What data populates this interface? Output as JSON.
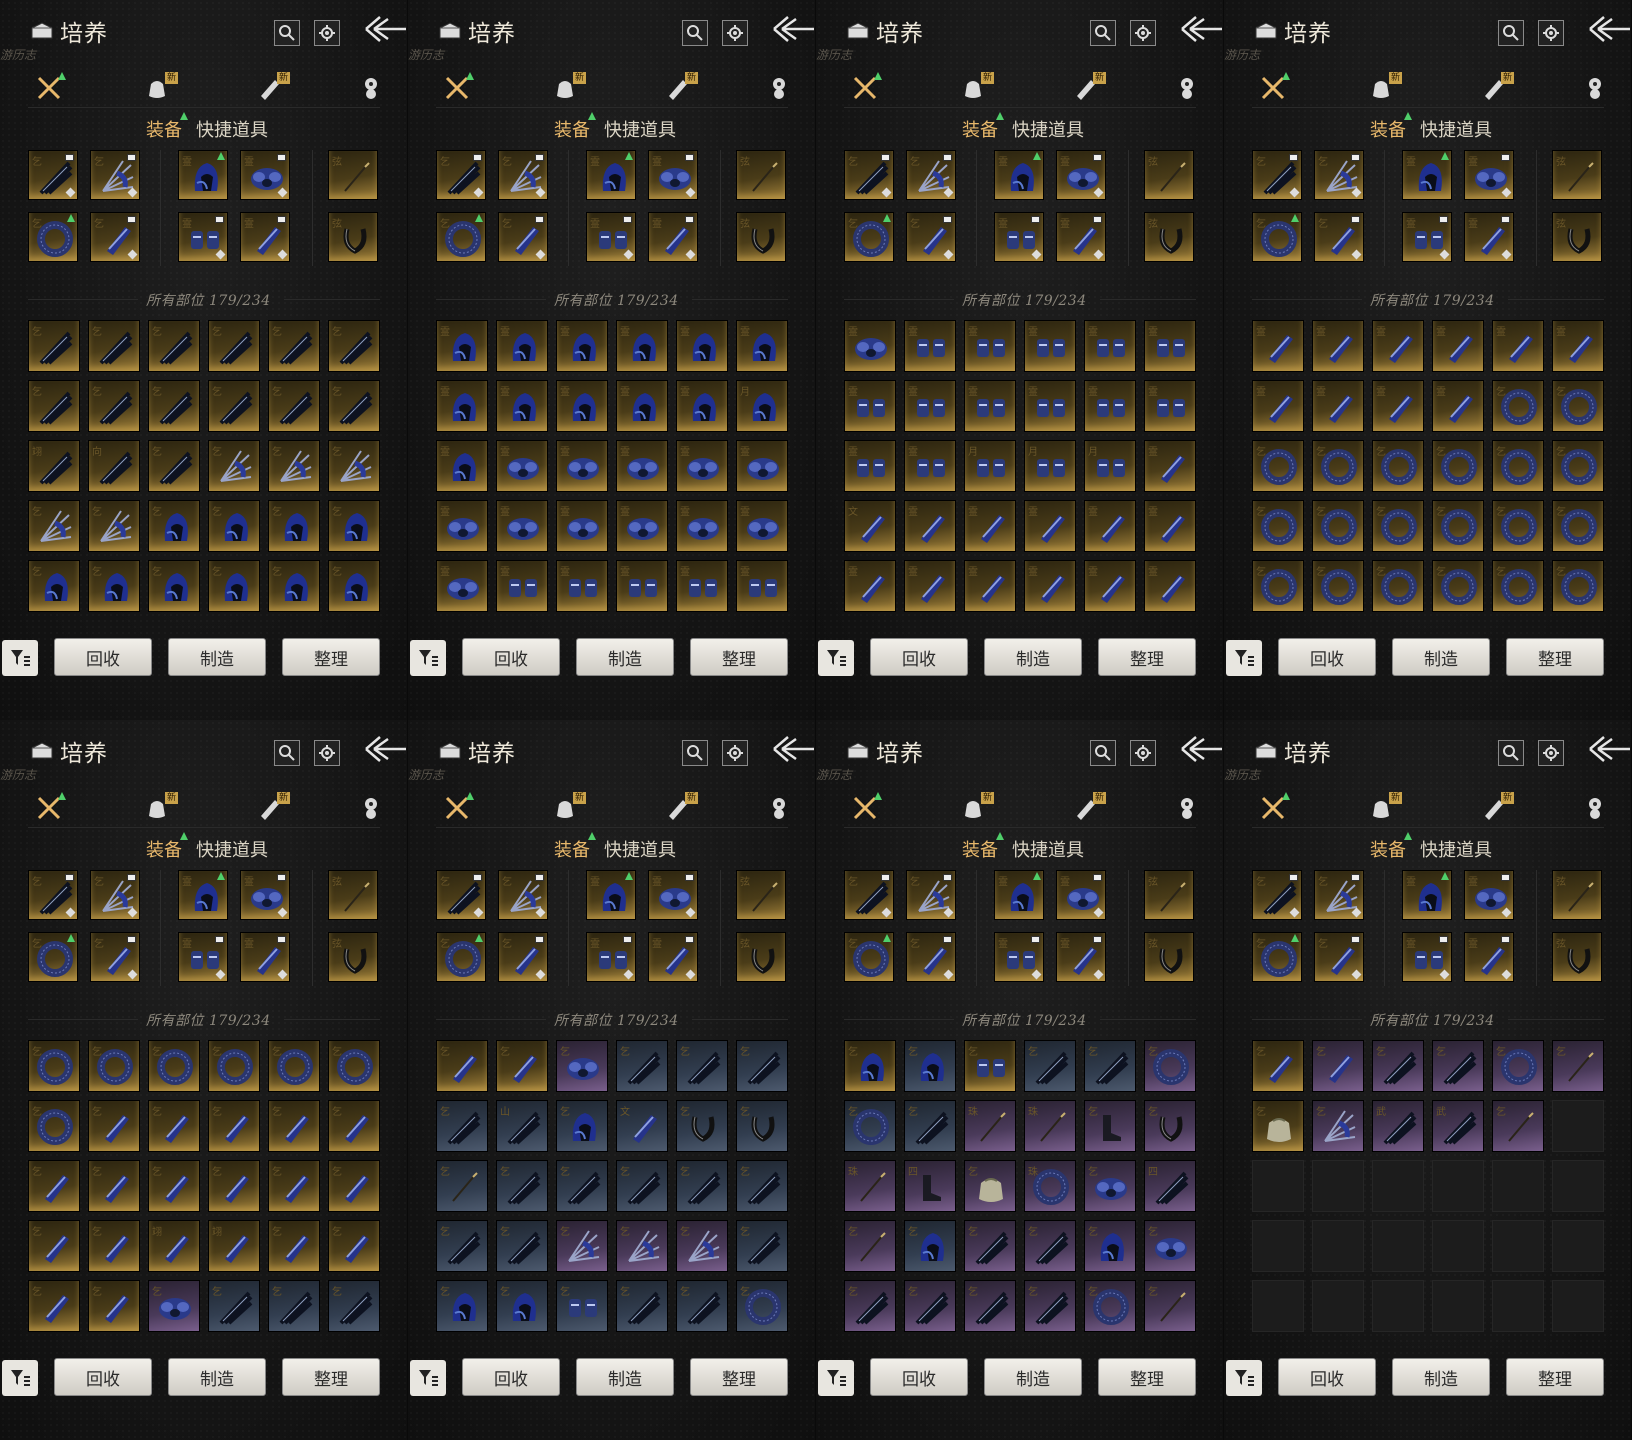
{
  "ui": {
    "title": "培养",
    "header_sub": "游历志",
    "tab_new_badge": "新",
    "subtab_equipment": "装备",
    "subtab_quick_items": "快捷道具",
    "section_label": "所有部位 179/234",
    "buttons": {
      "recycle": "回收",
      "craft": "制造",
      "sort": "整理"
    },
    "icons": {
      "header": "chest-icon",
      "search": "search-icon",
      "settings": "gear-icon",
      "back": "back-arrow-icon",
      "filter": "filter-icon",
      "tabs": [
        "crossed-swords-icon",
        "pouch-icon",
        "scroll-icon",
        "sigil-icon"
      ]
    }
  },
  "equipped": [
    {
      "glyph": "乞",
      "kind": "spear",
      "mark": true
    },
    {
      "glyph": "乞",
      "kind": "fan",
      "mark": true
    },
    {
      "glyph": "霊",
      "kind": "hood",
      "upg": true
    },
    {
      "glyph": "霊",
      "kind": "armor",
      "mark": true
    },
    {
      "glyph": "弦",
      "kind": "wand",
      "dots": true
    },
    {
      "glyph": "乞",
      "kind": "ring",
      "upg": true
    },
    {
      "glyph": "乞",
      "kind": "bracer",
      "mark": true
    },
    {
      "glyph": "霊",
      "kind": "gloves",
      "mark": true
    },
    {
      "glyph": "霊",
      "kind": "bracer",
      "mark": true
    },
    {
      "glyph": "弦",
      "kind": "amulet",
      "dots": true
    }
  ],
  "panels": [
    {
      "rows": [
        [
          "gold:spear:乞",
          "gold:spear:乞",
          "gold:spear:乞",
          "gold:spear:乞",
          "gold:spear:乞",
          "gold:spear:乞"
        ],
        [
          "gold:spear:乞",
          "gold:spear:乞",
          "gold:spear:乞",
          "gold:spear:乞",
          "gold:spear:乞",
          "gold:spear:乞"
        ],
        [
          "gold:spear:翊",
          "gold:spear:向",
          "gold:spear:乞",
          "gold:fan:乞",
          "gold:fan:乞",
          "gold:fan:乞"
        ],
        [
          "gold:fan:乞",
          "gold:fan:乞",
          "gold:hood:乞",
          "gold:hood:乞",
          "gold:hood:乞",
          "gold:hood:乞"
        ],
        [
          "gold:hood:乞",
          "gold:hood:乞",
          "gold:hood:乞",
          "gold:hood:乞",
          "gold:hood:乞",
          "gold:hood:乞"
        ]
      ]
    },
    {
      "rows": [
        [
          "gold:hood:霊",
          "gold:hood:霊",
          "gold:hood:霊",
          "gold:hood:霊",
          "gold:hood:霊",
          "gold:hood:霊"
        ],
        [
          "gold:hood:霊",
          "gold:hood:霊",
          "gold:hood:霊",
          "gold:hood:霊",
          "gold:hood:霊",
          "gold:hood:月"
        ],
        [
          "gold:hood:霊",
          "gold:armor:霊",
          "gold:armor:霊",
          "gold:armor:霊",
          "gold:armor:霊",
          "gold:armor:霊"
        ],
        [
          "gold:armor:霊",
          "gold:armor:霊",
          "gold:armor:霊",
          "gold:armor:霊",
          "gold:armor:霊",
          "gold:armor:霊"
        ],
        [
          "gold:armor:霊",
          "gold:gloves:霊",
          "gold:gloves:霊",
          "gold:gloves:霊",
          "gold:gloves:霊",
          "gold:gloves:霊"
        ]
      ]
    },
    {
      "rows": [
        [
          "gold:armor:霊",
          "gold:gloves:霊",
          "gold:gloves:霊",
          "gold:gloves:霊",
          "gold:gloves:霊",
          "gold:gloves:霊"
        ],
        [
          "gold:gloves:霊",
          "gold:gloves:霊",
          "gold:gloves:霊",
          "gold:gloves:霊",
          "gold:gloves:霊",
          "gold:gloves:霊"
        ],
        [
          "gold:gloves:霊",
          "gold:gloves:霊",
          "gold:gloves:月",
          "gold:gloves:月",
          "gold:gloves:月",
          "gold:bracer:霊"
        ],
        [
          "gold:bracer:文",
          "gold:bracer:霊",
          "gold:bracer:霊",
          "gold:bracer:霊",
          "gold:bracer:霊",
          "gold:bracer:霊"
        ],
        [
          "gold:bracer:霊",
          "gold:bracer:霊",
          "gold:bracer:霊",
          "gold:bracer:霊",
          "gold:bracer:霊",
          "gold:bracer:霊"
        ]
      ]
    },
    {
      "rows": [
        [
          "gold:bracer:霊",
          "gold:bracer:霊",
          "gold:bracer:霊",
          "gold:bracer:霊",
          "gold:bracer:霊",
          "gold:bracer:霊"
        ],
        [
          "gold:bracer:霊",
          "gold:bracer:霊",
          "gold:bracer:霊",
          "gold:bracer:霊",
          "gold:ring:乞",
          "gold:ring:乞"
        ],
        [
          "gold:ring:乞",
          "gold:ring:乞",
          "gold:ring:乞",
          "gold:ring:乞",
          "gold:ring:乞",
          "gold:ring:乞"
        ],
        [
          "gold:ring:乞",
          "gold:ring:乞",
          "gold:ring:乞",
          "gold:ring:乞",
          "gold:ring:乞",
          "gold:ring:乞"
        ],
        [
          "gold:ring:乞",
          "gold:ring:乞",
          "gold:ring:乞",
          "gold:ring:乞",
          "gold:ring:乞",
          "gold:ring:乞"
        ]
      ]
    },
    {
      "rows": [
        [
          "gold:ring:乞",
          "gold:ring:乞",
          "gold:ring:乞",
          "gold:ring:乞",
          "gold:ring:乞",
          "gold:ring:乞"
        ],
        [
          "gold:ring:乞",
          "gold:bracer:乞",
          "gold:bracer:乞",
          "gold:bracer:乞",
          "gold:bracer:乞",
          "gold:bracer:乞"
        ],
        [
          "gold:bracer:乞",
          "gold:bracer:乞",
          "gold:bracer:乞",
          "gold:bracer:乞",
          "gold:bracer:乞",
          "gold:bracer:乞"
        ],
        [
          "gold:bracer:乞",
          "gold:bracer:乞",
          "gold:bracer:翊",
          "gold:bracer:翊",
          "gold:bracer:乞",
          "gold:bracer:乞"
        ],
        [
          "gold:bracer:乞",
          "gold:bracer:乞",
          "purple:armor:乞",
          "blue:spear:乞",
          "blue:spear:乞",
          "blue:spear:乞"
        ]
      ]
    },
    {
      "rows": [
        [
          "gold:bracer:乞",
          "gold:bracer:乞",
          "purple:armor:乞",
          "blue:spear:乞",
          "blue:spear:乞",
          "blue:spear:乞"
        ],
        [
          "blue:spear:乞",
          "blue:spear:山",
          "blue:hood:乞",
          "blue:bracer:文",
          "blue:amulet:乞",
          "blue:amulet:乞"
        ],
        [
          "blue:wand:乞",
          "blue:spear:乞",
          "blue:spear:乞",
          "blue:spear:乞",
          "blue:spear:乞",
          "blue:spear:乞"
        ],
        [
          "blue:spear:乞",
          "blue:spear:乞",
          "purple:fan:乞",
          "purple:fan:乞",
          "purple:fan:乞",
          "blue:spear:乞"
        ],
        [
          "blue:hood:乞",
          "blue:hood:乞",
          "blue:gloves:乞",
          "blue:spear:乞",
          "blue:spear:乞",
          "blue:ring:乞"
        ]
      ]
    },
    {
      "rows": [
        [
          "gold:hood:乞",
          "blue:hood:乞",
          "gold:gloves:乞",
          "blue:spear:乞",
          "blue:spear:乞",
          "purple:ring:乞"
        ],
        [
          "blue:ring:乞",
          "blue:spear:乞",
          "purple:wand:珠",
          "purple:wand:珠",
          "purple:boots:乞",
          "purple:amulet:乞"
        ],
        [
          "purple:wand:珠",
          "purple:boots:四",
          "purple:pouch:乞",
          "purple:ring:珠",
          "purple:armor:乞",
          "purple:spear:四"
        ],
        [
          "purple:wand:乞",
          "blue:hood:乞",
          "purple:spear:乞",
          "purple:spear:乞",
          "purple:hood:乞",
          "purple:armor:乞"
        ],
        [
          "purple:spear:乞",
          "purple:spear:乞",
          "purple:spear:乞",
          "purple:spear:乞",
          "purple:ring:乞",
          "purple:wand:乞"
        ]
      ]
    },
    {
      "rows": [
        [
          "gold:bracer:乞",
          "purple:bracer:乞",
          "purple:spear:乞",
          "purple:spear:乞",
          "purple:ring:乞",
          "purple:wand:乞"
        ],
        [
          "gold:pouch:乞",
          "purple:fan:乞",
          "purple:spear:武",
          "purple:spear:武",
          "purple:wand:乞",
          "empty"
        ],
        [
          "empty",
          "empty",
          "empty",
          "empty",
          "empty",
          "empty"
        ],
        [
          "empty",
          "empty",
          "empty",
          "empty",
          "empty",
          "empty"
        ],
        [
          "empty",
          "empty",
          "empty",
          "empty",
          "empty",
          "empty"
        ]
      ]
    }
  ]
}
